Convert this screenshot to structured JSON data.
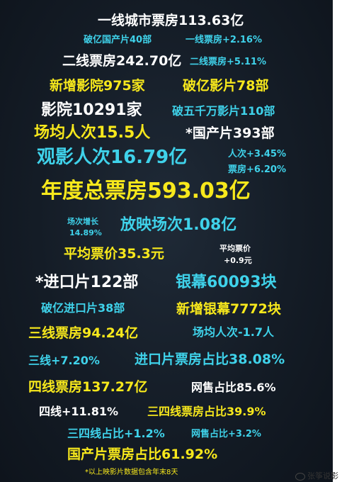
{
  "poster": {
    "lines": [
      "一线城市票房113.63亿",
      "破亿国产片40部",
      "一线票房+2.16%",
      "二线票房242.70亿",
      "二线票房+5.11%",
      "新增影院975家",
      "破亿影片78部",
      "影院10291家",
      "破五千万影片110部",
      "场均人次15.5人",
      "*国产片393部",
      "观影人次16.79亿",
      "人次+3.45%",
      "票房+6.20%",
      "年度总票房593.03亿",
      "场次增长",
      "14.89%",
      "放映场次1.08亿",
      "平均票价35.3元",
      "平均票价",
      "+0.9元",
      "*进口片122部",
      "银幕60093块",
      "破亿进口片38部",
      "新增银幕7772块",
      "三线票房94.24亿",
      "场均人次-1.7人",
      "三线+7.20%",
      "进口片票房占比38.08%",
      "四线票房137.27亿",
      "网售占比85.6%",
      "四线+11.81%",
      "三四线票房占比39.9%",
      "三四线占比+1.2%",
      "网售占比+3.2%",
      "国产片票房占比61.92%",
      "*以上映影片数据包含年末8天"
    ]
  },
  "watermark": "张筝说影",
  "colors": {
    "white": "#ffffff",
    "cyan": "#3fd2ea",
    "yellow": "#f7e81c",
    "background": "#141c26"
  }
}
